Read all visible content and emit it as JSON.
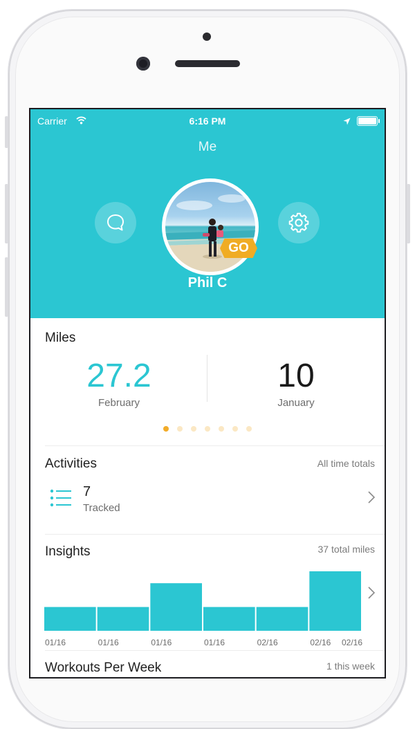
{
  "status_bar": {
    "carrier": "Carrier",
    "time": "6:16 PM"
  },
  "header": {
    "title": "Me",
    "user_name": "Phil C",
    "badge": "GO"
  },
  "colors": {
    "accent": "#2bc6d2",
    "badge": "#f0ac24"
  },
  "icons": {
    "left_button": "chat-bubble-icon",
    "right_button": "gear-icon"
  },
  "miles": {
    "label": "Miles",
    "current": {
      "value": "27.2",
      "month": "February"
    },
    "previous": {
      "value": "10",
      "month": "January"
    },
    "pager_count": 7,
    "pager_active_index": 0
  },
  "activities": {
    "label": "Activities",
    "aside": "All time totals",
    "count": "7",
    "count_label": "Tracked"
  },
  "insights": {
    "label": "Insights",
    "aside": "37 total miles"
  },
  "chart_data": {
    "type": "bar",
    "categories": [
      "01/16",
      "01/16",
      "01/16",
      "01/16",
      "02/16",
      "02/16"
    ],
    "values": [
      4,
      4,
      8,
      4,
      4,
      10
    ],
    "ylim": [
      0,
      10
    ]
  },
  "workouts": {
    "label": "Workouts Per Week",
    "aside": "1 this week"
  }
}
